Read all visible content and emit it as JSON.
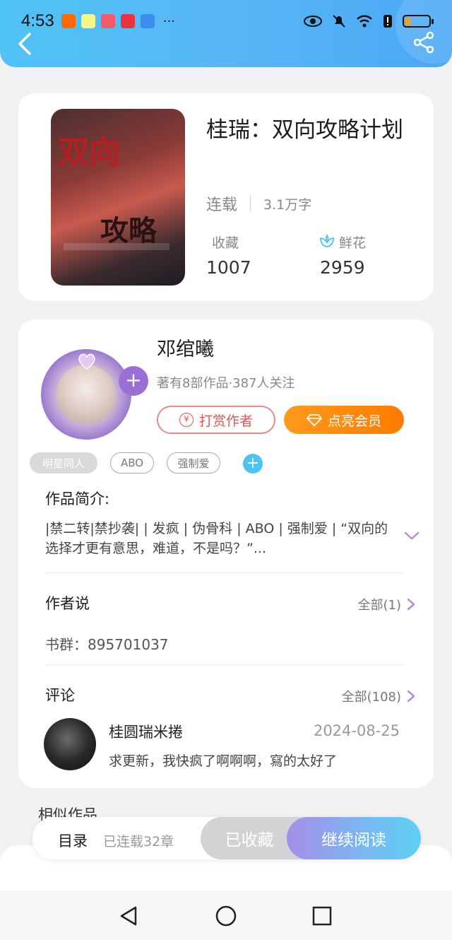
{
  "status_bar": {
    "time": "4:53",
    "dots": "···"
  },
  "book": {
    "title": "桂瑞：双向攻略计划",
    "cover_text_1": "双向",
    "cover_text_2": "攻略",
    "serial_status": "连载",
    "word_count": "3.1万字",
    "collect_label": "收藏",
    "collect_count": "1007",
    "flower_label": "鲜花",
    "flower_count": "2959"
  },
  "author": {
    "name": "邓绾曦",
    "stats": "著有8部作品·387人关注",
    "follow_symbol": "+",
    "tip_label": "打赏作者",
    "tip_symbol": "¥",
    "vip_label": "点亮会员"
  },
  "tags": [
    "明星同人",
    "ABO",
    "强制爱"
  ],
  "tag_add_symbol": "+",
  "intro": {
    "title": "作品简介:",
    "text": "|禁二转|禁抄袭| | 发疯 | 伪骨科 | ABO | 强制爱 | “双向的选择才更有意思，难道，不是吗？”..."
  },
  "author_says": {
    "title": "作者说",
    "see_all": "全部(1)",
    "text": "书群：895701037"
  },
  "comments": {
    "title": "评论",
    "see_all": "全部(108)",
    "items": [
      {
        "user": "桂圆瑞米捲",
        "date": "2024-08-25",
        "text": "求更新，我快疯了啊啊啊，寫的太好了"
      }
    ]
  },
  "similar": {
    "title": "相似作品"
  },
  "bottom_bar": {
    "toc_label": "目录",
    "toc_status": "已连载32章",
    "collected_label": "已收藏",
    "read_label": "继续阅读"
  },
  "colors": {
    "header": "#4fc3f7",
    "accent_orange": "#ff8c00",
    "accent_purple": "#9b6fd6",
    "tip_red": "#e25555"
  }
}
